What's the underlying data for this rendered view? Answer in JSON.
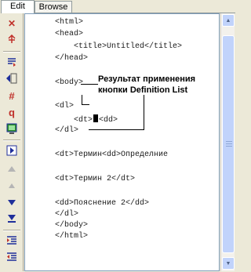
{
  "tabs": {
    "edit": "Edit",
    "browse": "Browse"
  },
  "toolbar": {
    "icons": [
      "close-icon",
      "insert-tag-icon",
      "list-icon",
      "definition-list-icon",
      "hash-icon",
      "paragraph-icon",
      "monitor-icon",
      "play-icon",
      "up-icon",
      "up-small-icon",
      "down-icon",
      "down-end-icon",
      "indent-icon",
      "outdent-icon"
    ],
    "symbols": {
      "close": "✕",
      "hash": "#",
      "paragraph": "q"
    },
    "colors": {
      "red": "#c0312b",
      "blue": "#1f2f9b",
      "green": "#2a8a2a"
    }
  },
  "editor": {
    "lines": [
      "<html>",
      "<head>",
      "    <title>Untitled</title>",
      "</head>",
      "<body>",
      "<dl>",
      "    <dt>",
      "<dd>",
      "</dl>",
      "<dt>Термин<dd>Определние",
      "<dt>Термин 2</dt>",
      "<dd>Пояснение 2</dd>",
      "</dl>",
      "</body>",
      "</html>"
    ]
  },
  "callout": {
    "text": "Результат применения кнопки Definition List"
  }
}
